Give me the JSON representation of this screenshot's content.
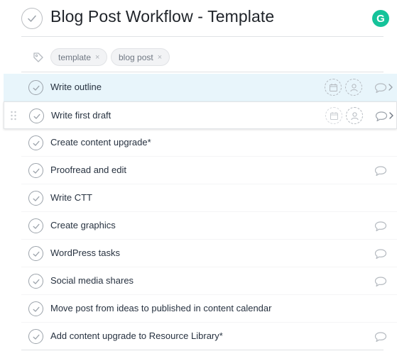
{
  "header": {
    "title": "Blog Post Workflow - Template",
    "grammarly_badge": "G"
  },
  "tags": [
    {
      "label": "template",
      "remove": "×"
    },
    {
      "label": "blog post",
      "remove": "×"
    }
  ],
  "tasks": [
    {
      "name": "Write outline",
      "state": "hover",
      "has_comment": true
    },
    {
      "name": "Write first draft",
      "state": "drag",
      "has_comment": true
    },
    {
      "name": "Create content upgrade*",
      "state": "normal",
      "has_comment": false
    },
    {
      "name": "Proofread and edit",
      "state": "normal",
      "has_comment": true
    },
    {
      "name": "Write CTT",
      "state": "normal",
      "has_comment": false
    },
    {
      "name": "Create graphics",
      "state": "normal",
      "has_comment": true
    },
    {
      "name": "WordPress tasks",
      "state": "normal",
      "has_comment": true
    },
    {
      "name": "Social media shares",
      "state": "normal",
      "has_comment": true
    },
    {
      "name": "Move post from ideas to published in content calendar",
      "state": "normal",
      "has_comment": false
    },
    {
      "name": "Add content upgrade to Resource Library*",
      "state": "normal",
      "has_comment": true
    }
  ],
  "colors": {
    "hover_row": "#e8f5fb",
    "grammarly": "#15c39a",
    "check": "#9ca3ab"
  },
  "icons": [
    "check-icon",
    "tag-icon",
    "calendar-icon",
    "assignee-icon",
    "comment-icon",
    "chevron-right-icon",
    "drag-handle-icon"
  ]
}
